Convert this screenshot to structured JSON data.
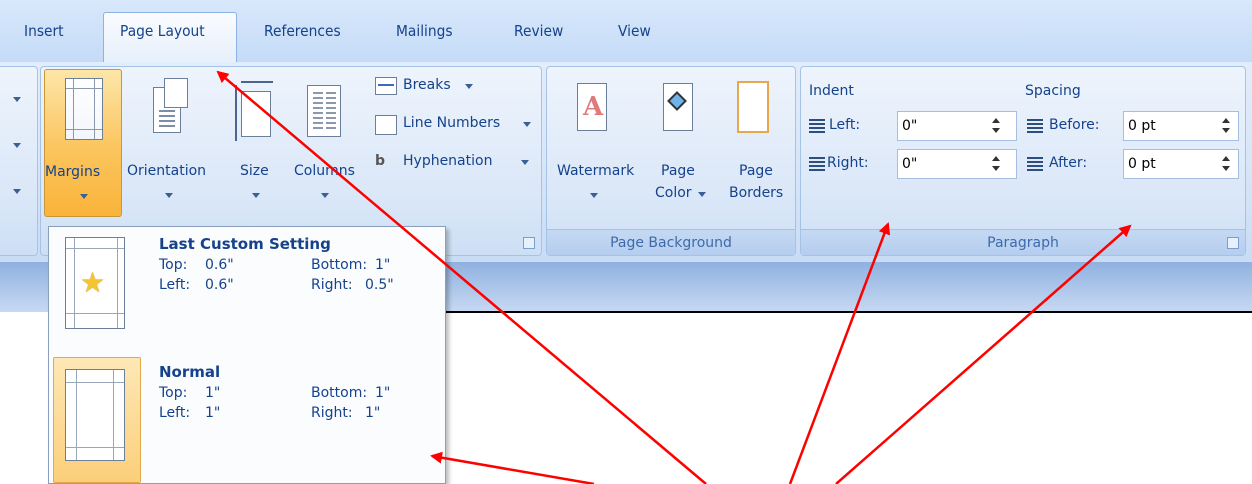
{
  "tabs": {
    "insert": "Insert",
    "page_layout": "Page Layout",
    "references": "References",
    "mailings": "Mailings",
    "review": "Review",
    "view": "View"
  },
  "page_setup": {
    "margins": "Margins",
    "orientation": "Orientation",
    "size": "Size",
    "columns": "Columns",
    "breaks": "Breaks",
    "line_numbers": "Line Numbers",
    "hyphenation": "Hyphenation"
  },
  "page_background": {
    "watermark": "Watermark",
    "page_color_1": "Page",
    "page_color_2": "Color",
    "page_borders_1": "Page",
    "page_borders_2": "Borders",
    "label": "Page Background"
  },
  "paragraph": {
    "indent_title": "Indent",
    "left_label": "Left:",
    "left_value": "0\"",
    "right_label": "Right:",
    "right_value": "0\"",
    "spacing_title": "Spacing",
    "before_label": "Before:",
    "before_value": "0 pt",
    "after_label": "After:",
    "after_value": "0 pt",
    "label": "Paragraph"
  },
  "margins_menu": {
    "items": [
      {
        "title": "Last Custom Setting",
        "top_label": "Top:",
        "top_value": "0.6\"",
        "bottom_label": "Bottom:",
        "bottom_value": "1\"",
        "left_label": "Left:",
        "left_value": "0.6\"",
        "right_label": "Right:",
        "right_value": "0.5\""
      },
      {
        "title": "Normal",
        "top_label": "Top:",
        "top_value": "1\"",
        "bottom_label": "Bottom:",
        "bottom_value": "1\"",
        "left_label": "Left:",
        "left_value": "1\"",
        "right_label": "Right:",
        "right_value": "1\""
      }
    ]
  },
  "colors": {
    "accent_text": "#15428b",
    "selected_button": "#fbc45d",
    "annotation_arrow": "#ff0000"
  }
}
